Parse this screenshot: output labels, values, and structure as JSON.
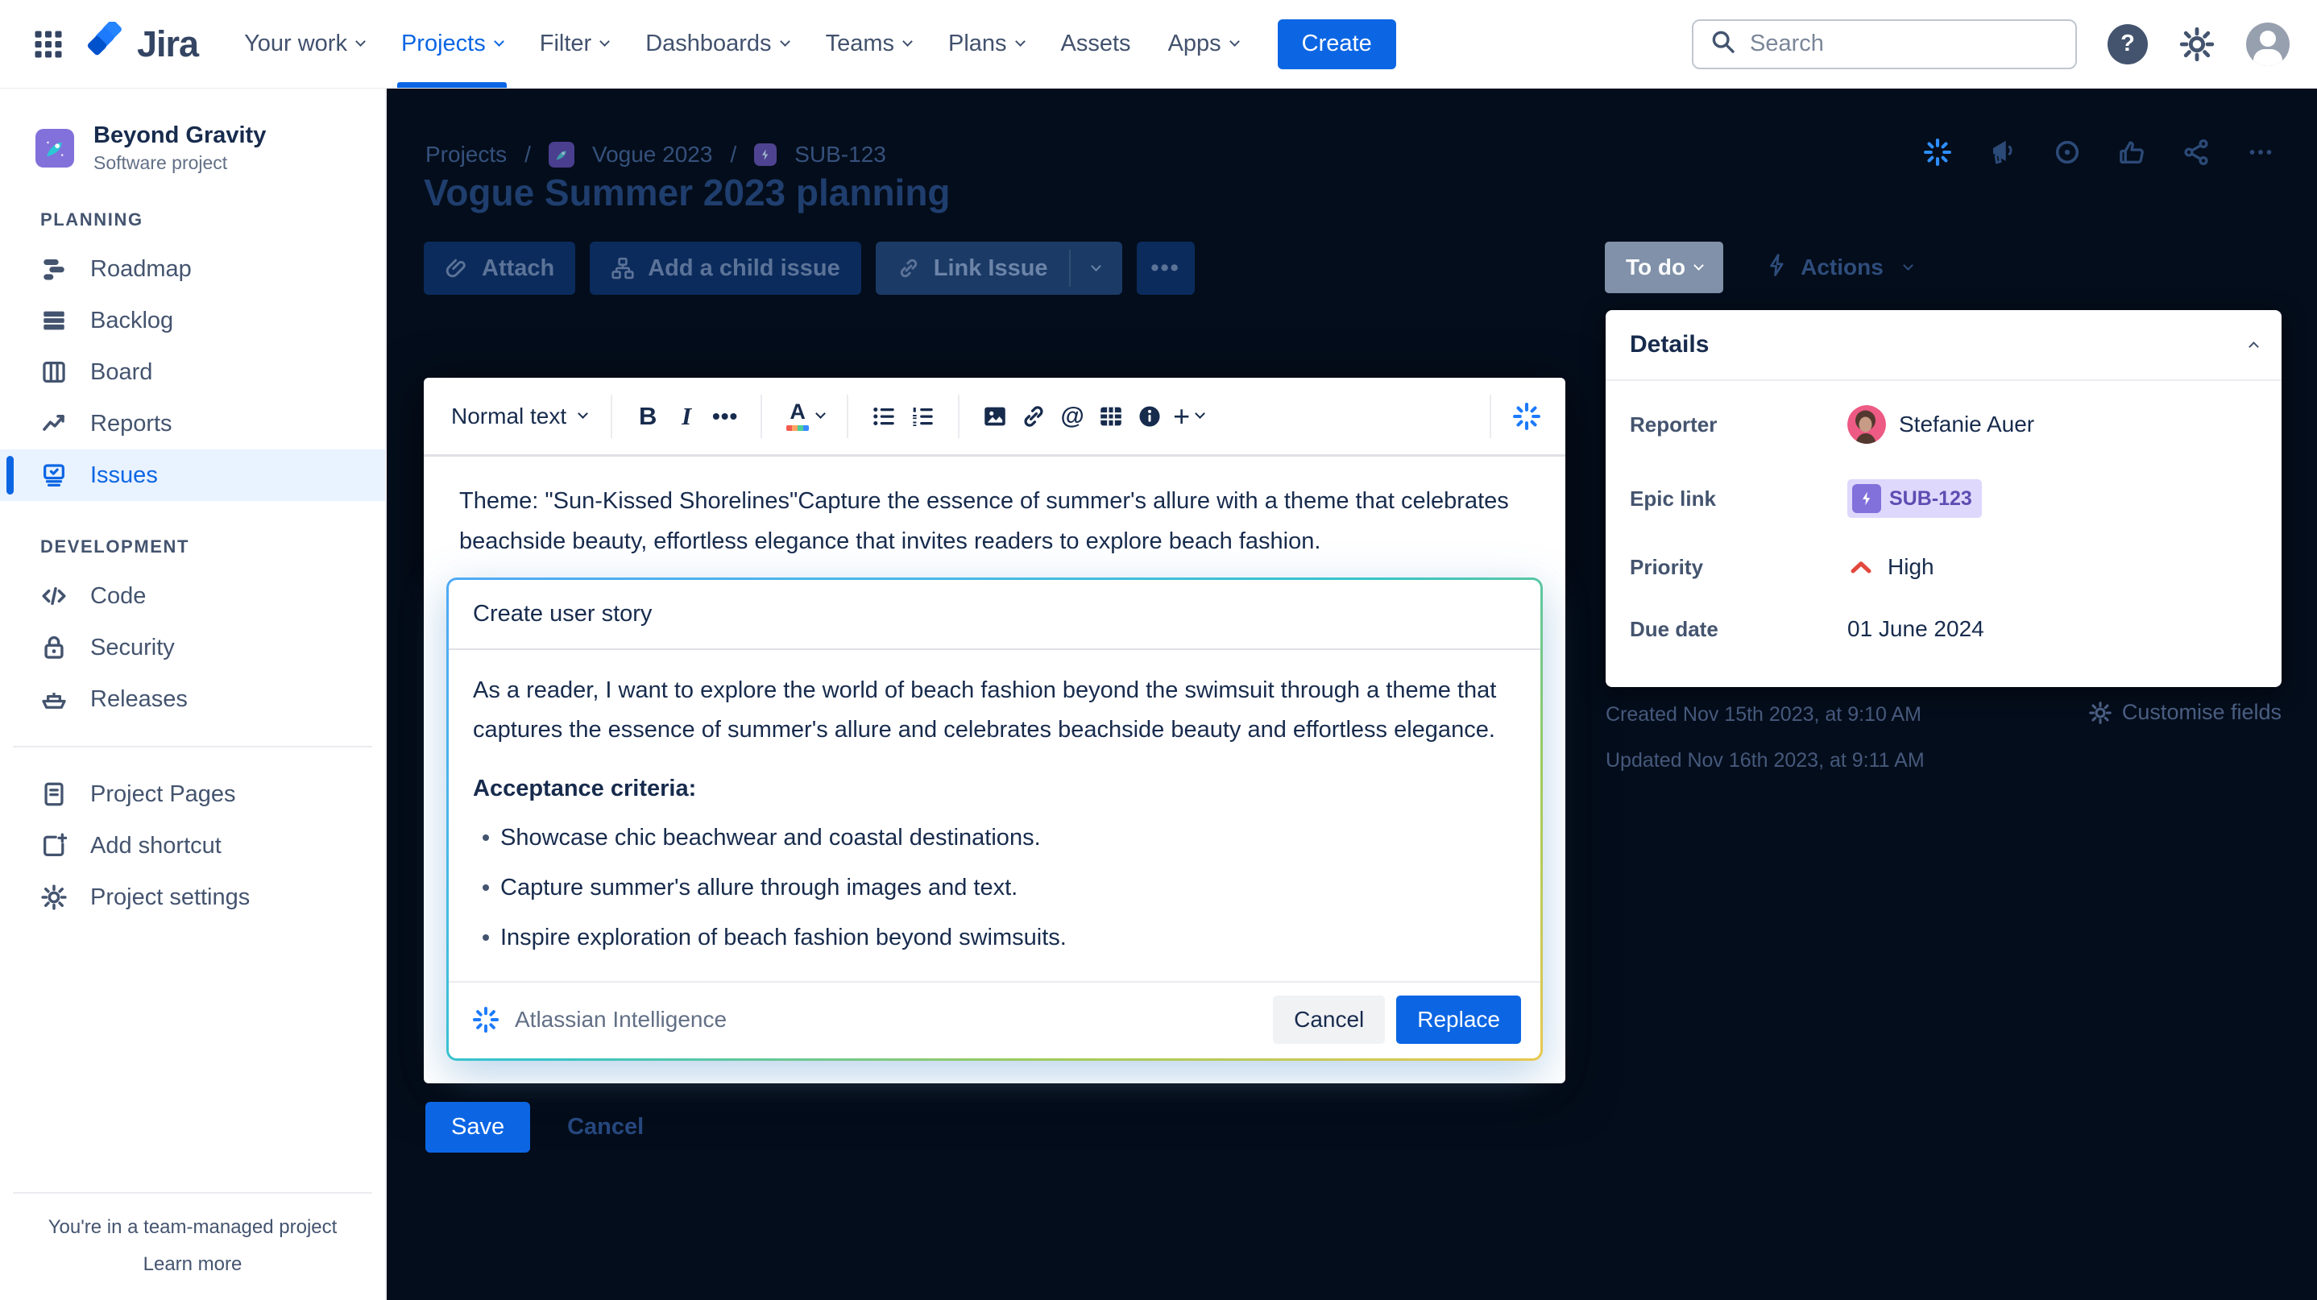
{
  "nav": {
    "logo": "Jira",
    "items": [
      {
        "label": "Your work"
      },
      {
        "label": "Projects"
      },
      {
        "label": "Filter"
      },
      {
        "label": "Dashboards"
      },
      {
        "label": "Teams"
      },
      {
        "label": "Plans"
      },
      {
        "label": "Assets"
      },
      {
        "label": "Apps"
      }
    ],
    "create": "Create",
    "search_placeholder": "Search",
    "help": "?"
  },
  "sidebar": {
    "project": {
      "name": "Beyond Gravity",
      "type": "Software project"
    },
    "planning_title": "PLANNING",
    "planning": [
      {
        "label": "Roadmap"
      },
      {
        "label": "Backlog"
      },
      {
        "label": "Board"
      },
      {
        "label": "Reports"
      },
      {
        "label": "Issues"
      }
    ],
    "development_title": "DEVELOPMENT",
    "development": [
      {
        "label": "Code"
      },
      {
        "label": "Security"
      },
      {
        "label": "Releases"
      }
    ],
    "shortcuts": [
      {
        "label": "Project Pages"
      },
      {
        "label": "Add shortcut"
      },
      {
        "label": "Project settings"
      }
    ],
    "footer_line1": "You're in a team-managed project",
    "footer_link": "Learn more"
  },
  "main": {
    "breadcrumb": {
      "projects": "Projects",
      "sep1": "/",
      "project": "Vogue 2023",
      "sep2": "/",
      "issue": "SUB-123"
    },
    "title": "Vogue Summer 2023 planning",
    "buttons": {
      "attach": "Attach",
      "add_child": "Add a child issue",
      "link_issue": "Link Issue",
      "more": "•••"
    },
    "editor": {
      "style": "Normal text",
      "description": "Theme:  \"Sun-Kissed Shorelines\"Capture the essence of summer's allure with a theme that celebrates beachside beauty, effortless elegance that invites readers to explore  beach fashion.",
      "save": "Save",
      "cancel": "Cancel"
    },
    "ai": {
      "title": "Create user story",
      "body": "As a reader, I want to explore the world of beach fashion beyond the swimsuit through a theme that captures the essence of summer's allure and celebrates beachside beauty and effortless elegance.",
      "criteria_heading": "Acceptance criteria:",
      "criteria": [
        {
          "text": "Showcase chic beachwear and coastal destinations."
        },
        {
          "text": "Capture summer's allure through images and text."
        },
        {
          "text": "Inspire exploration of beach fashion beyond swimsuits."
        }
      ],
      "brand": "Atlassian Intelligence",
      "cancel": "Cancel",
      "replace": "Replace"
    }
  },
  "details": {
    "status": "To do",
    "actions": "Actions",
    "title": "Details",
    "reporter_label": "Reporter",
    "reporter": "Stefanie Auer",
    "epic_label": "Epic link",
    "epic": "SUB-123",
    "priority_label": "Priority",
    "priority": "High",
    "due_label": "Due date",
    "due": "01 June 2024",
    "created": "Created Nov 15th 2023, at 9:10 AM",
    "updated": "Updated Nov 16th 2023, at 9:11 AM",
    "customise": "Customise fields"
  },
  "colors": {
    "brand_blue": "#0C66E4",
    "ai_blue": "#1D7AFC",
    "priority_high": "#E2483D",
    "epic_purple": "#5E4DB2",
    "overlay_bg": "#040D1B",
    "ai_gradient": [
      "#4FA9F5",
      "#35C4C9",
      "#E9C84F"
    ]
  }
}
